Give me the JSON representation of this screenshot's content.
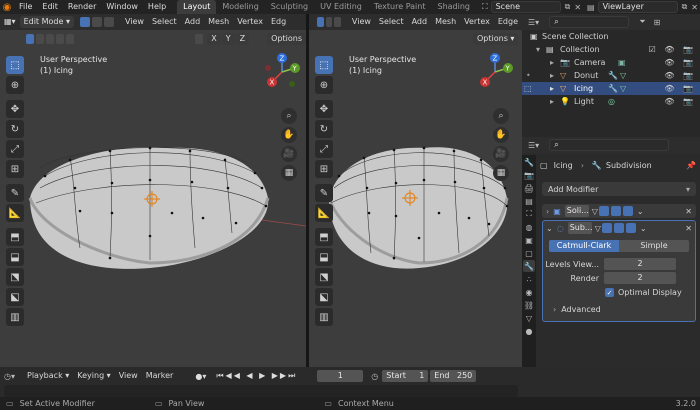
{
  "menu": [
    "File",
    "Edit",
    "Render",
    "Window",
    "Help"
  ],
  "workspaces": [
    {
      "label": "Layout",
      "active": true
    },
    {
      "label": "Modeling",
      "active": false
    },
    {
      "label": "Sculpting",
      "active": false
    },
    {
      "label": "UV Editing",
      "active": false
    },
    {
      "label": "Texture Paint",
      "active": false
    },
    {
      "label": "Shading",
      "active": false
    }
  ],
  "scene": "Scene",
  "view_layer": "ViewLayer",
  "viewport": {
    "mode": "Edit Mode",
    "menus_left": [
      "View",
      "Select",
      "Add",
      "Mesh",
      "Vertex",
      "Edg"
    ],
    "menus_right": [
      "View",
      "Select",
      "Add",
      "Mesh",
      "Vertex",
      "Edge"
    ],
    "xyz": [
      "X",
      "Y",
      "Z"
    ],
    "options": "Options",
    "perspective": "User Perspective",
    "object": "(1) Icing",
    "gizmo": {
      "z": "Z",
      "y": "Y",
      "x": "X"
    }
  },
  "outliner": {
    "root": "Scene Collection",
    "collection": "Collection",
    "items": [
      {
        "label": "Camera",
        "selected": false
      },
      {
        "label": "Donut",
        "selected": false
      },
      {
        "label": "Icing",
        "selected": true
      },
      {
        "label": "Light",
        "selected": false
      }
    ]
  },
  "properties": {
    "object": "Icing",
    "modifier": "Subdivision",
    "add_modifier": "Add Modifier",
    "mod1_name": "Soli...",
    "mod2_name": "Sub...",
    "catmull": "Catmull-Clark",
    "simple": "Simple",
    "levels_label": "Levels View...",
    "levels_value": "2",
    "render_label": "Render",
    "render_value": "2",
    "optimal": "Optimal Display",
    "advanced": "Advanced"
  },
  "timeline": {
    "menus": [
      "Playback",
      "Keying",
      "View",
      "Marker"
    ],
    "frame": "1",
    "start_label": "Start",
    "start": "1",
    "end_label": "End",
    "end": "250"
  },
  "status": {
    "left": "Set Active Modifier",
    "mid": "Pan View",
    "right": "Context Menu",
    "version": "3.2.0"
  },
  "colors": {
    "accent": "#4772b3",
    "select": "#334d80",
    "orange": "#e87d0d"
  }
}
